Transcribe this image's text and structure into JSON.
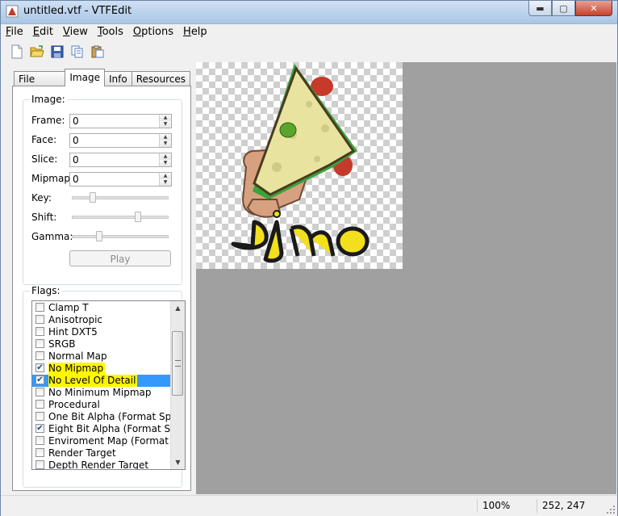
{
  "window": {
    "title": "untitled.vtf - VTFEdit"
  },
  "menu": [
    "File",
    "Edit",
    "View",
    "Tools",
    "Options",
    "Help"
  ],
  "toolbar": {
    "icons": [
      "new-file-icon",
      "open-folder-icon",
      "save-icon",
      "copy-icon",
      "paste-icon"
    ]
  },
  "tabs": [
    {
      "label": "File System",
      "active": false
    },
    {
      "label": "Image",
      "active": true
    },
    {
      "label": "Info",
      "active": false
    },
    {
      "label": "Resources",
      "active": false
    }
  ],
  "image_group": {
    "title": "Image:",
    "frame": {
      "label": "Frame:",
      "value": "0"
    },
    "face": {
      "label": "Face:",
      "value": "0"
    },
    "slice": {
      "label": "Slice:",
      "value": "0"
    },
    "mipmap": {
      "label": "Mipmap:",
      "value": "0"
    },
    "key": {
      "label": "Key:",
      "level": 0.2
    },
    "shift": {
      "label": "Shift:",
      "level": 0.7
    },
    "gamma": {
      "label": "Gamma:",
      "level": 0.27
    },
    "play_label": "Play"
  },
  "flags_group": {
    "title": "Flags:",
    "items": [
      {
        "label": "Clamp T",
        "checked": false
      },
      {
        "label": "Anisotropic",
        "checked": false
      },
      {
        "label": "Hint DXT5",
        "checked": false
      },
      {
        "label": "SRGB",
        "checked": false
      },
      {
        "label": "Normal Map",
        "checked": false
      },
      {
        "label": "No Mipmap",
        "checked": true
      },
      {
        "label": "No Level Of Detail",
        "checked": true
      },
      {
        "label": "No Minimum Mipmap",
        "checked": false
      },
      {
        "label": "Procedural",
        "checked": false
      },
      {
        "label": "One Bit Alpha (Format Spec",
        "checked": false
      },
      {
        "label": "Eight Bit Alpha (Format Spec",
        "checked": true
      },
      {
        "label": "Enviroment Map (Format Sp",
        "checked": false
      },
      {
        "label": "Render Target",
        "checked": false
      },
      {
        "label": "Depth Render Target",
        "checked": false
      }
    ]
  },
  "status": {
    "zoom": "100%",
    "coords": "252, 247"
  }
}
